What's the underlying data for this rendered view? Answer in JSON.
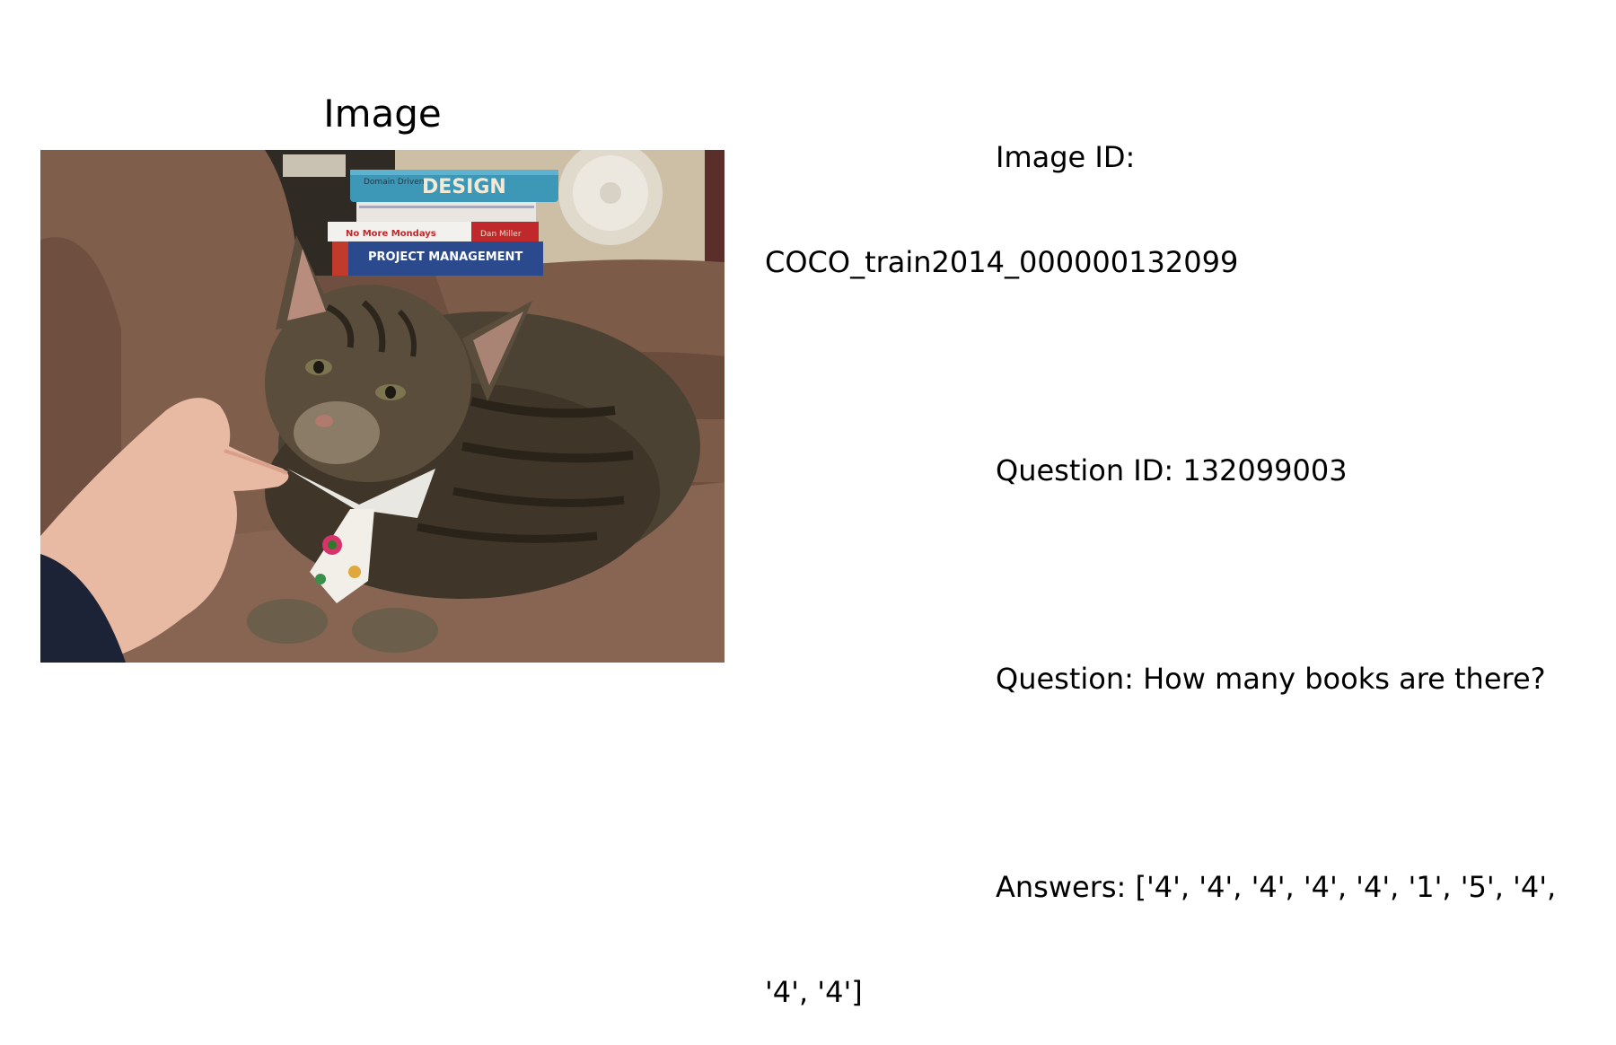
{
  "panel": {
    "title": "Image"
  },
  "info": {
    "image_id_label": "Image ID:",
    "image_id_value": "COCO_train2014_000000132099",
    "question_id": "Question ID: 132099003",
    "question": "Question: How many books are there?",
    "answers_line1": "Answers: ['4', '4', '4', '4', '4', '1', '5', '4',",
    "answers_line2": "'4', '4']"
  },
  "photo": {
    "book_titles": {
      "top": "DESIGN",
      "top_sub": "Domain Driven",
      "third": "No More Mondays",
      "third_author": "Dan Miller",
      "bottom": "PROJECT MANAGEMENT"
    }
  }
}
